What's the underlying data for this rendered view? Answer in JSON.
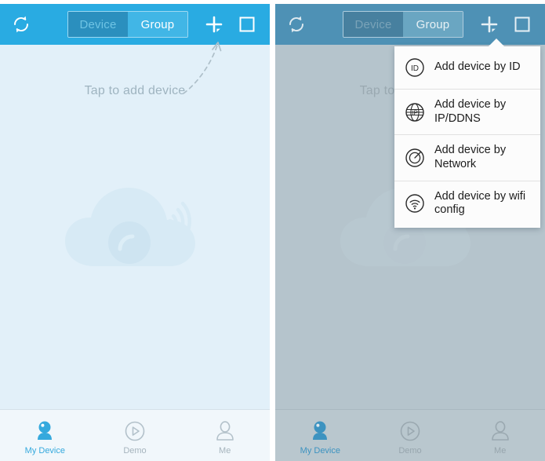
{
  "app": {
    "header": {
      "refresh_icon": "refresh-icon",
      "segments": [
        {
          "label": "Device",
          "selected": false
        },
        {
          "label": "Group",
          "selected": true
        }
      ],
      "add_icon": "add-device-plus-icon",
      "multiview_icon": "square-grid-icon"
    },
    "content": {
      "hint_text": "Tap to add device",
      "arrow_icon": "dashed-curved-arrow-icon",
      "watermark_icon": "cloud-camera-wifi-icon"
    },
    "tabbar": [
      {
        "label": "My Device",
        "icon": "camera-icon",
        "active": true
      },
      {
        "label": "Demo",
        "icon": "play-circle-icon",
        "active": false
      },
      {
        "label": "Me",
        "icon": "person-icon",
        "active": false
      }
    ]
  },
  "menu": {
    "caret_icon": "caret-up-icon",
    "items": [
      {
        "label": "Add device by ID",
        "icon": "id-circle-icon"
      },
      {
        "label": "Add device by IP/DDNS",
        "icon": "globe-ip-icon"
      },
      {
        "label": "Add device by Network",
        "icon": "network-radar-icon"
      },
      {
        "label": "Add device by wifi config",
        "icon": "wifi-circle-icon"
      }
    ]
  },
  "colors": {
    "brand_blue": "#29abe2",
    "segment_active": "#41b6e6",
    "segment_inactive": "#2b8fbe",
    "screen_bg": "#e2f0f9",
    "screen_bg_dimmed": "#b5c4cc",
    "tab_active": "#35a9dd",
    "tab_idle": "#a6b4bd",
    "menu_bg": "#fcfcfc",
    "menu_text": "#1d1d1d",
    "hint_text": "#9fb4c0"
  }
}
